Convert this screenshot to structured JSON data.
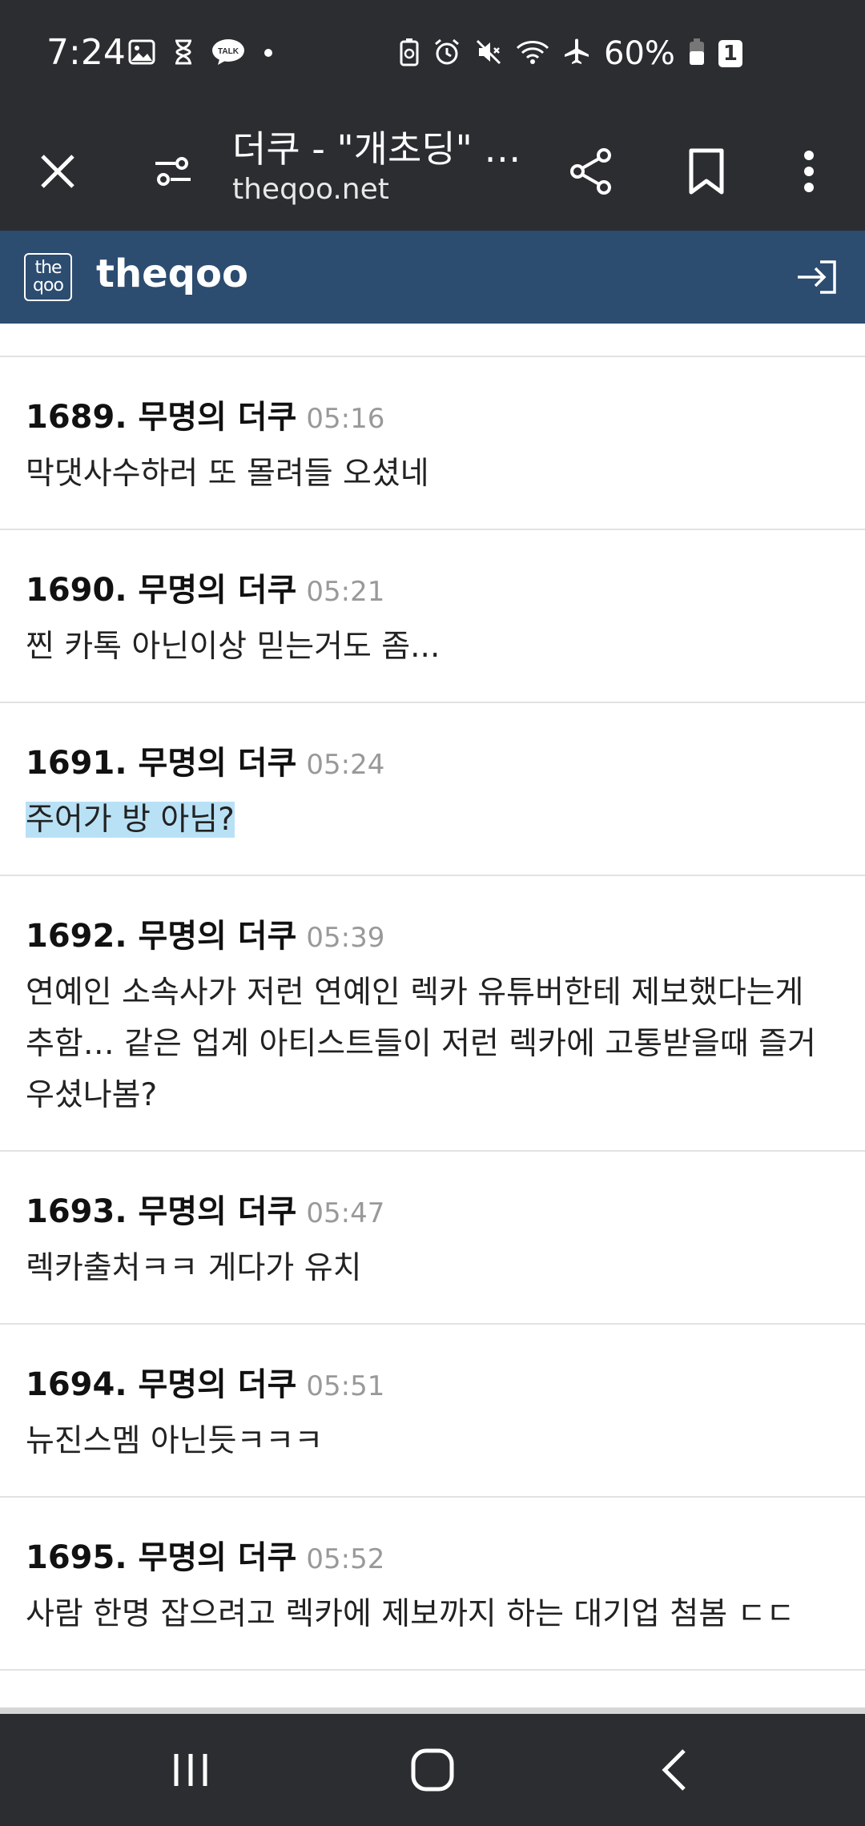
{
  "status": {
    "time": "7:24",
    "battery": "60%",
    "sim_badge": "1"
  },
  "browser": {
    "tab_title": "더쿠 - \"개초딩\" \"...",
    "domain": "theqoo.net"
  },
  "site": {
    "logo_text": "the qoo",
    "name": "theqoo"
  },
  "comments": [
    {
      "number": "1689.",
      "author": "무명의 더쿠",
      "time": "05:16",
      "body": "막댓사수하러 또 몰려들 오셨네",
      "highlighted": false
    },
    {
      "number": "1690.",
      "author": "무명의 더쿠",
      "time": "05:21",
      "body": "찐 카톡 아닌이상 믿는거도 좀...",
      "highlighted": false
    },
    {
      "number": "1691.",
      "author": "무명의 더쿠",
      "time": "05:24",
      "body": "주어가 방 아님?",
      "highlighted": true
    },
    {
      "number": "1692.",
      "author": "무명의 더쿠",
      "time": "05:39",
      "body": "연예인 소속사가 저런 연예인 렉카 유튜버한테 제보했다는게 추함… 같은 업계 아티스트들이 저런 렉카에 고통받을때 즐거우셨나봄?",
      "highlighted": false
    },
    {
      "number": "1693.",
      "author": "무명의 더쿠",
      "time": "05:47",
      "body": "렉카출처ㅋㅋ 게다가 유치",
      "highlighted": false
    },
    {
      "number": "1694.",
      "author": "무명의 더쿠",
      "time": "05:51",
      "body": "뉴진스멤 아닌듯ㅋㅋㅋ",
      "highlighted": false
    },
    {
      "number": "1695.",
      "author": "무명의 더쿠",
      "time": "05:52",
      "body": "사람 한명 잡으려고 렉카에 제보까지 하는 대기업 첨봄 ㄷㄷ",
      "highlighted": false
    }
  ],
  "icons": {
    "close": "close-icon",
    "page_info": "tune-icon",
    "share": "share-icon",
    "bookmark": "bookmark-icon",
    "menu": "more-vert-icon",
    "login": "login-icon"
  },
  "colors": {
    "status_bg": "#2b2d31",
    "site_header": "#2c4c70",
    "highlight": "#b9e1f5"
  }
}
